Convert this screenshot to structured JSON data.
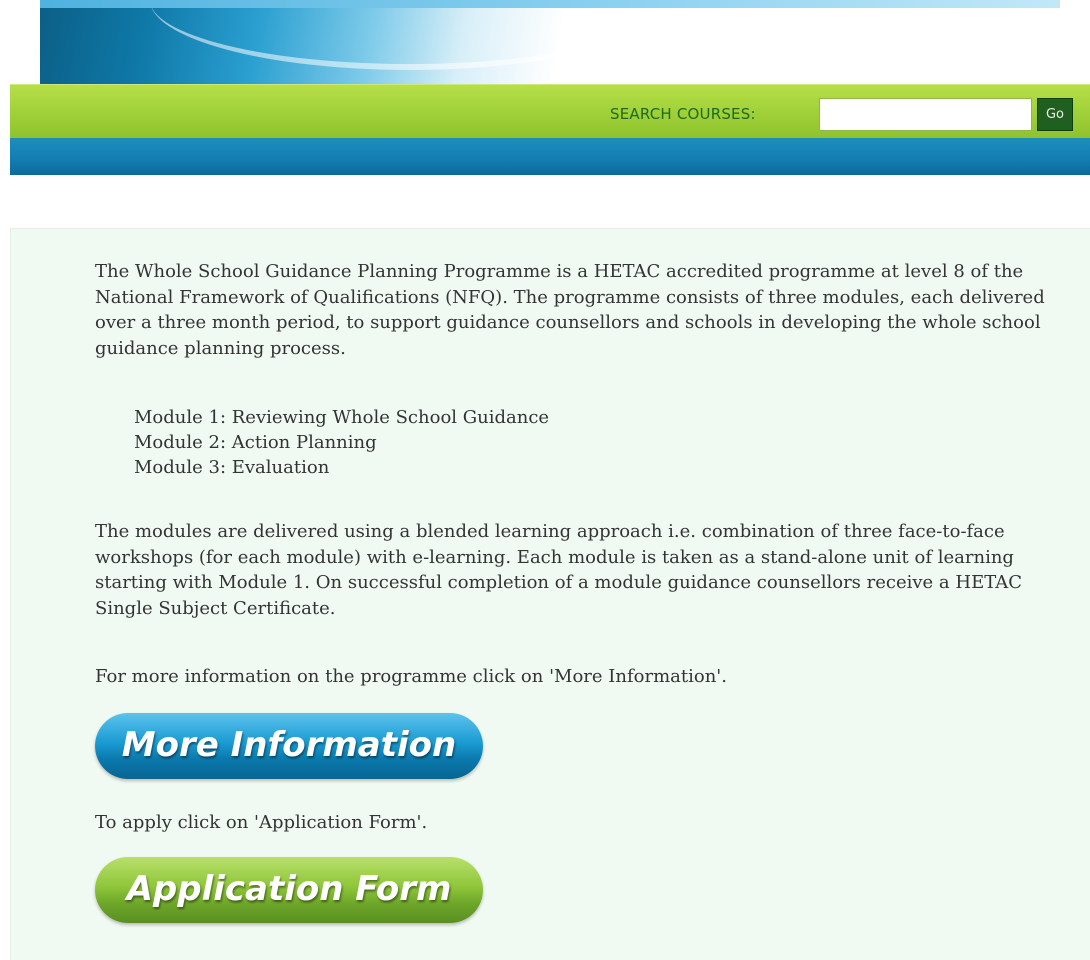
{
  "header": {
    "search_label": "SEARCH COURSES:",
    "search_value": "",
    "go_label": "Go"
  },
  "content": {
    "intro": "The Whole School Guidance Planning Programme is a HETAC accredited programme at level 8 of the National Framework of Qualifications (NFQ).  The programme consists of three modules, each delivered over a three month period, to support guidance counsellors and schools in developing the whole school guidance planning process.",
    "modules": [
      "Module 1: Reviewing Whole School Guidance",
      "Module 2: Action Planning",
      "Module 3: Evaluation"
    ],
    "blended": "The modules are delivered using a blended learning approach i.e. combination of three face-to-face workshops (for each module) with e-learning.  Each module is taken as a stand-alone unit of learning starting with Module 1.  On successful completion of a module guidance counsellors receive a HETAC Single Subject Certificate.",
    "more_info_text": "For more information on the programme click on 'More Information'.",
    "more_info_button": "More Information",
    "apply_text": "To apply click on 'Application Form'.",
    "apply_button": "Application Form"
  },
  "colors": {
    "search_bar": "#a3d33b",
    "blue_strip": "#137cb0",
    "go_button": "#1f5f1f",
    "panel_bg": "#f1faf2"
  }
}
